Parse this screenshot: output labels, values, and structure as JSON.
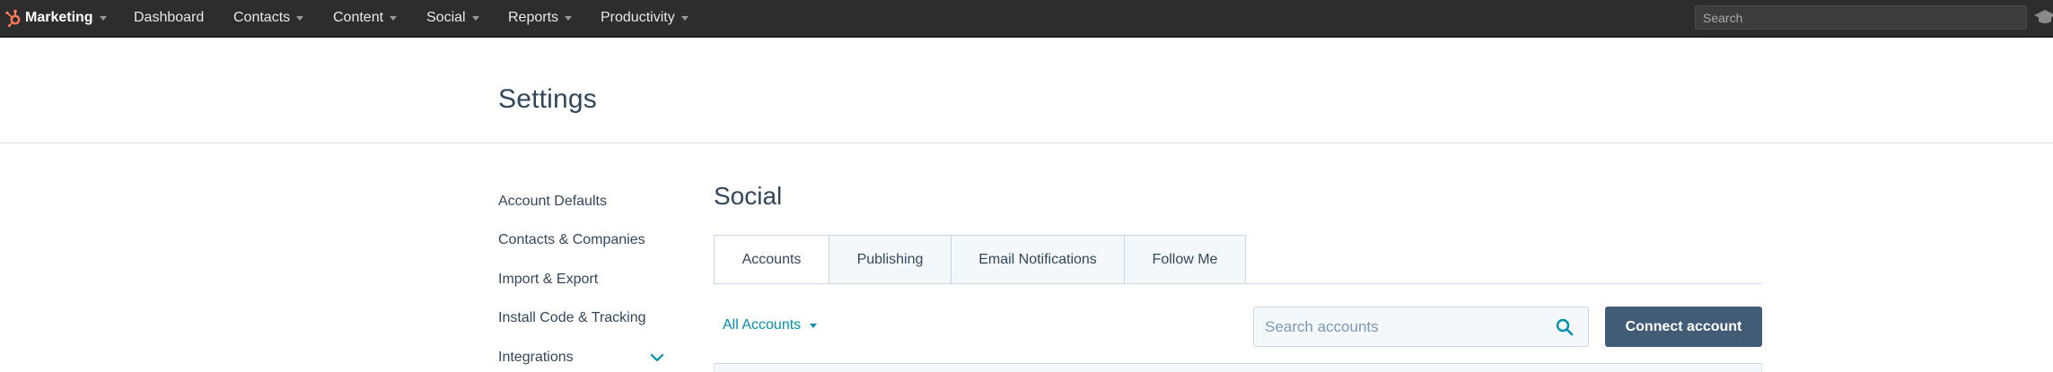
{
  "topnav": {
    "brand": "Marketing",
    "items": [
      "Dashboard",
      "Contacts",
      "Content",
      "Social",
      "Reports",
      "Productivity"
    ],
    "search_placeholder": "Search",
    "brand_color": "#ff7a59",
    "background": "#2d2d2d"
  },
  "header": {
    "title": "Settings"
  },
  "sidebar": {
    "items": [
      "Account Defaults",
      "Contacts & Companies",
      "Import & Export",
      "Install Code & Tracking",
      "Integrations"
    ]
  },
  "main": {
    "title": "Social",
    "tabs": [
      "Accounts",
      "Publishing",
      "Email Notifications",
      "Follow Me"
    ],
    "active_tab": "Accounts",
    "filter_label": "All Accounts",
    "search_placeholder": "Search accounts",
    "connect_label": "Connect account",
    "accent_color": "#0091ae",
    "button_color": "#425b76"
  }
}
